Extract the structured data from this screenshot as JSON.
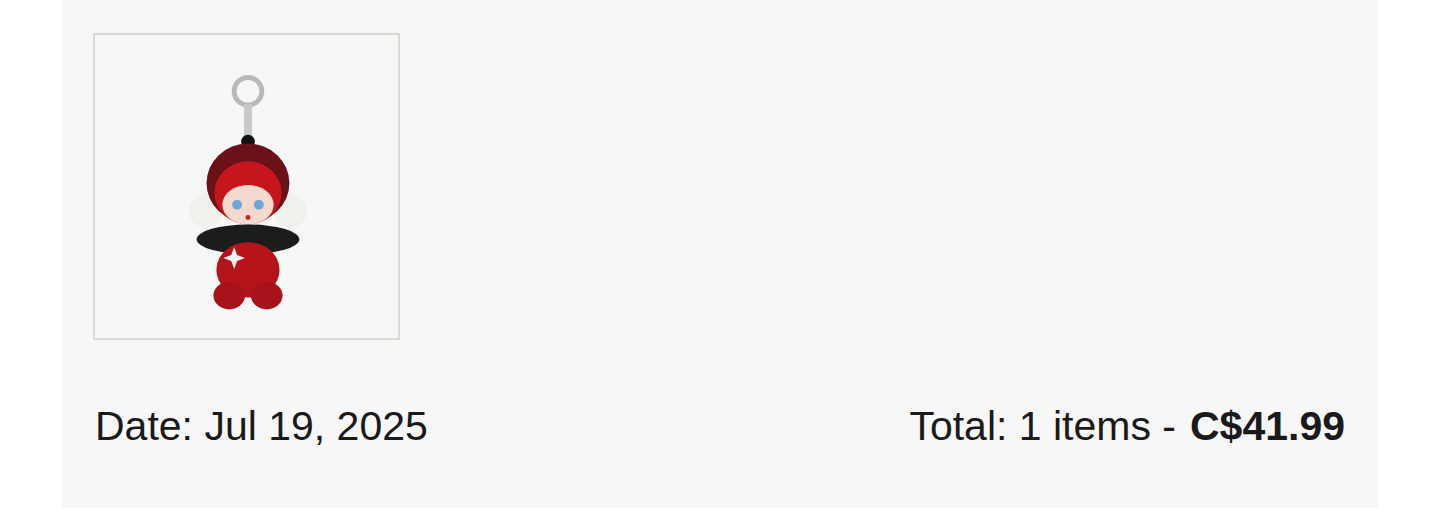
{
  "order": {
    "date": "Date: Jul 19, 2025",
    "total_label": "Total: 1 items -",
    "total_amount": "C$41.99"
  }
}
